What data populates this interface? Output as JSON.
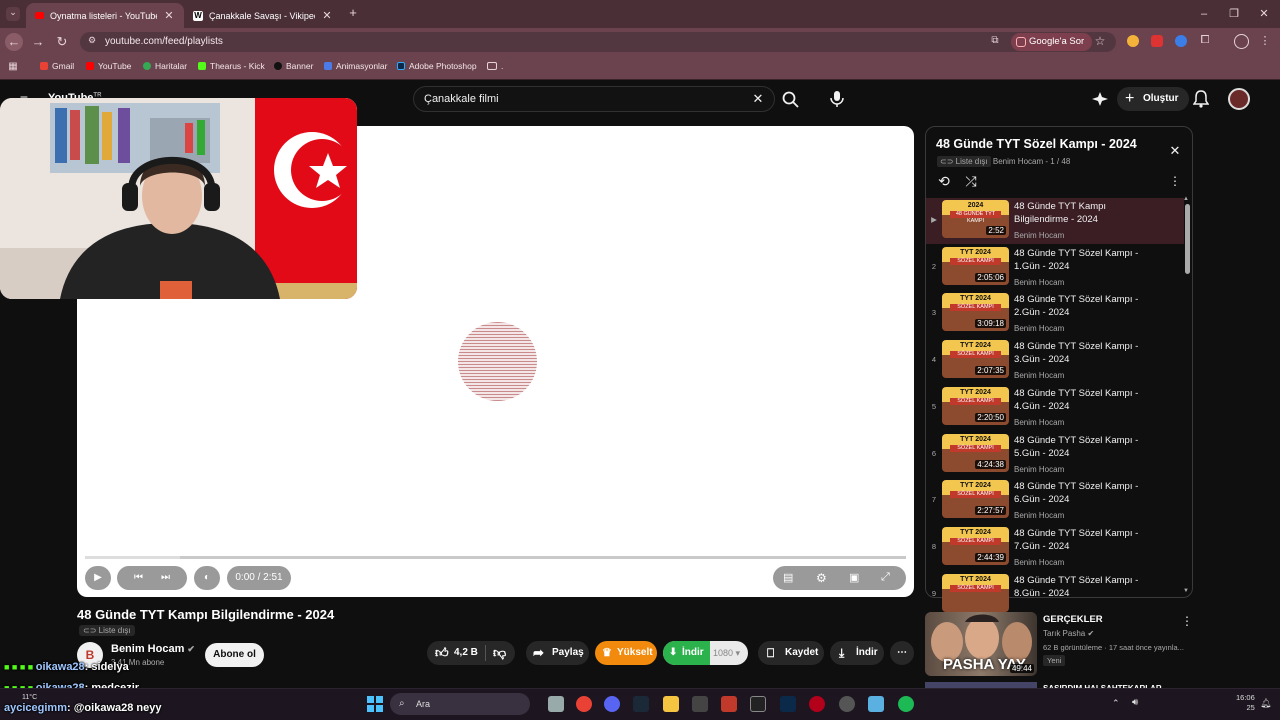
{
  "browser": {
    "tabs": [
      {
        "title": "Oynatma listeleri - YouTube",
        "active": true,
        "icon": "youtube-icon"
      },
      {
        "title": "Çanakkale Savaşı - Vikipedi",
        "active": false,
        "icon": "wikipedia-icon"
      }
    ],
    "url": "youtube.com/feed/playlists",
    "ask_google": "Google'a Sor",
    "bookmarks": [
      "Gmail",
      "YouTube",
      "Haritalar",
      "Thearus - Kick",
      "Banner",
      "Animasyonlar",
      "Adobe Photoshop",
      "."
    ]
  },
  "youtube": {
    "logo_text": "YouTube",
    "logo_region": "TR",
    "search_value": "Çanakkale filmi",
    "create_label": "Oluştur"
  },
  "player": {
    "time": "0:00 / 2:51",
    "quality": "1080"
  },
  "video": {
    "title": "48 Günde TYT Kampı Bilgilendirme - 2024",
    "unlisted": "Liste dışı",
    "channel": "Benim Hocam",
    "subscribers": "3,41 Mn abone",
    "subscribe_label": "Abone ol",
    "likes": "4,2 B",
    "share_label": "Paylaş",
    "upgrade_label": "Yükselt",
    "download_ext_label": "İndir",
    "save_label": "Kaydet",
    "download_label": "İndir"
  },
  "playlist": {
    "title": "48 Günde TYT Sözel Kampı - 2024",
    "status": "Liste dışı",
    "owner": "Benim Hocam",
    "position": "1 / 48",
    "items": [
      {
        "index": "▶",
        "title": "48 Günde TYT Kampı Bilgilendirme - 2024",
        "channel": "Benim Hocam",
        "duration": "2:52",
        "thumb_top": "2024",
        "thumb_band": "48 GÜNDE TYT KAMPI"
      },
      {
        "index": "2",
        "title": "48 Günde TYT Sözel Kampı - 1.Gün - 2024",
        "channel": "Benim Hocam",
        "duration": "2:05:06",
        "thumb_top": "TYT 2024",
        "thumb_band": "SÖZEL KAMPI"
      },
      {
        "index": "3",
        "title": "48 Günde TYT Sözel Kampı - 2.Gün - 2024",
        "channel": "Benim Hocam",
        "duration": "3:09:18",
        "thumb_top": "TYT 2024",
        "thumb_band": "SÖZEL KAMPI"
      },
      {
        "index": "4",
        "title": "48 Günde TYT Sözel Kampı - 3.Gün - 2024",
        "channel": "Benim Hocam",
        "duration": "2:07:35",
        "thumb_top": "TYT 2024",
        "thumb_band": "SÖZEL KAMPI"
      },
      {
        "index": "5",
        "title": "48 Günde TYT Sözel Kampı - 4.Gün - 2024",
        "channel": "Benim Hocam",
        "duration": "2:20:50",
        "thumb_top": "TYT 2024",
        "thumb_band": "SÖZEL KAMPI"
      },
      {
        "index": "6",
        "title": "48 Günde TYT Sözel Kampı - 5.Gün - 2024",
        "channel": "Benim Hocam",
        "duration": "4:24:38",
        "thumb_top": "TYT 2024",
        "thumb_band": "SÖZEL KAMPI"
      },
      {
        "index": "7",
        "title": "48 Günde TYT Sözel Kampı - 6.Gün - 2024",
        "channel": "Benim Hocam",
        "duration": "2:27:57",
        "thumb_top": "TYT 2024",
        "thumb_band": "SÖZEL KAMPI"
      },
      {
        "index": "8",
        "title": "48 Günde TYT Sözel Kampı - 7.Gün - 2024",
        "channel": "Benim Hocam",
        "duration": "2:44:39",
        "thumb_top": "TYT 2024",
        "thumb_band": "SÖZEL KAMPI"
      },
      {
        "index": "9",
        "title": "48 Günde TYT Sözel Kampı - 8.Gün - 2024",
        "channel": "Benim Hocam",
        "duration": "",
        "thumb_top": "TYT 2024",
        "thumb_band": "SÖZEL KAMPI"
      }
    ]
  },
  "recommendation": {
    "title": "GERÇEKLER",
    "channel": "Tarık Pasha",
    "meta": "62 B görüntüleme · 17 saat önce yayınla...",
    "badge": "Yeni",
    "duration": "49:44",
    "thumb_text": "PASHA YAY",
    "next_title": "ŞAŞIRDIM HALSAHTEKARLAR"
  },
  "chat": [
    {
      "user": "oikawa28",
      "message": ": sidelya"
    },
    {
      "user": "oikawa28",
      "message": ": medcezir"
    },
    {
      "user": "aycicegimm",
      "message": ": @oikawa28 neyy"
    }
  ],
  "taskbar": {
    "search_placeholder": "Ara",
    "weather": "11°C",
    "clock": "16:06",
    "date_fragment": "25"
  }
}
